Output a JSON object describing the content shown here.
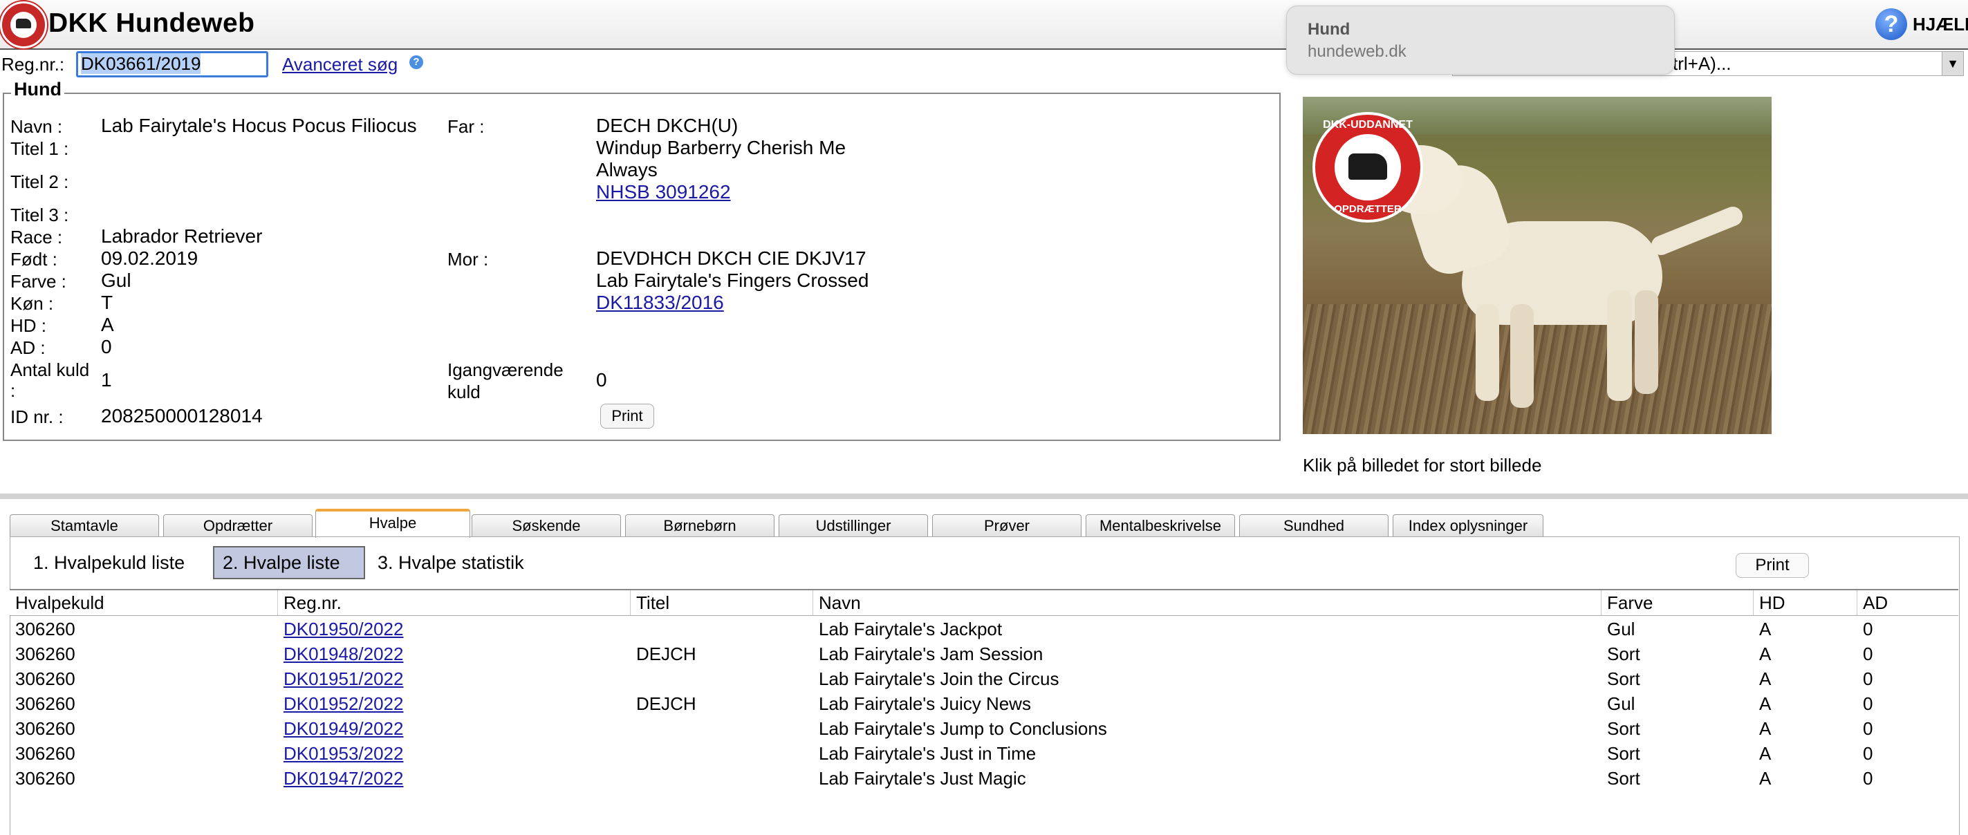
{
  "header": {
    "app_title": "DKK Hundeweb",
    "help_label": "HJÆLP"
  },
  "popup": {
    "title": "Hund",
    "url": "hundeweb.dk"
  },
  "search": {
    "regnr_label": "Reg.nr.:",
    "regnr_value": "DK03661/2019",
    "advanced_search": "Avanceret søg",
    "right_select_text": "trl+A)..."
  },
  "hund": {
    "legend": "Hund",
    "labels": {
      "navn": "Navn :",
      "titel1": "Titel 1 :",
      "titel2": "Titel 2 :",
      "titel3": "Titel 3 :",
      "race": "Race :",
      "fodt": "Født :",
      "farve": "Farve :",
      "kon": "Køn :",
      "hd": "HD :",
      "ad": "AD :",
      "antal_kuld_1": "Antal kuld",
      "antal_kuld_2": ":",
      "id_nr": "ID nr. :",
      "far": "Far :",
      "mor": "Mor :",
      "igang_1": "Igangværende",
      "igang_2": "kuld"
    },
    "values": {
      "navn": "Lab Fairytale's Hocus Pocus Filiocus",
      "race": "Labrador Retriever",
      "fodt": "09.02.2019",
      "farve": "Gul",
      "kon": "T",
      "hd": "A",
      "ad": "0",
      "antal_kuld": "1",
      "id_nr": "208250000128014",
      "far_titles": "DECH DKCH(U)",
      "far_name_1": "Windup Barberry Cherish Me",
      "far_name_2": "Always",
      "far_regnr": "NHSB 3091262",
      "mor_titles": "DEVDHCH DKCH CIE DKJV17",
      "mor_name": "Lab Fairytale's Fingers Crossed",
      "mor_regnr": "DK11833/2016",
      "igang_kuld": "0"
    },
    "print_label": "Print"
  },
  "photo": {
    "badge_top": "DKK-UDDANNET",
    "badge_bottom": "OPDRÆTTER",
    "caption": "Klik på billedet for stort billede"
  },
  "tabs": [
    {
      "label": "Stamtavle"
    },
    {
      "label": "Opdrætter"
    },
    {
      "label": "Hvalpe"
    },
    {
      "label": "Søskende"
    },
    {
      "label": "Børnebørn"
    },
    {
      "label": "Udstillinger"
    },
    {
      "label": "Prøver"
    },
    {
      "label": "Mentalbeskrivelse"
    },
    {
      "label": "Sundhed"
    },
    {
      "label": "Index oplysninger"
    }
  ],
  "subtabs": [
    {
      "label": "1. Hvalpekuld liste"
    },
    {
      "label": "2. Hvalpe liste"
    },
    {
      "label": "3. Hvalpe statistik"
    }
  ],
  "list_print_label": "Print",
  "table": {
    "headers": [
      "Hvalpekuld",
      "Reg.nr.",
      "Titel",
      "Navn",
      "Farve",
      "HD",
      "AD"
    ],
    "rows": [
      [
        "306260",
        "DK01950/2022",
        "",
        "Lab Fairytale's Jackpot",
        "Gul",
        "A",
        "0"
      ],
      [
        "306260",
        "DK01948/2022",
        "DEJCH",
        "Lab Fairytale's Jam Session",
        "Sort",
        "A",
        "0"
      ],
      [
        "306260",
        "DK01951/2022",
        "",
        "Lab Fairytale's Join the Circus",
        "Sort",
        "A",
        "0"
      ],
      [
        "306260",
        "DK01952/2022",
        "DEJCH",
        "Lab Fairytale's Juicy News",
        "Gul",
        "A",
        "0"
      ],
      [
        "306260",
        "DK01949/2022",
        "",
        "Lab Fairytale's Jump to Conclusions",
        "Sort",
        "A",
        "0"
      ],
      [
        "306260",
        "DK01953/2022",
        "",
        "Lab Fairytale's Just in Time",
        "Sort",
        "A",
        "0"
      ],
      [
        "306260",
        "DK01947/2022",
        "",
        "Lab Fairytale's Just Magic",
        "Sort",
        "A",
        "0"
      ]
    ]
  }
}
